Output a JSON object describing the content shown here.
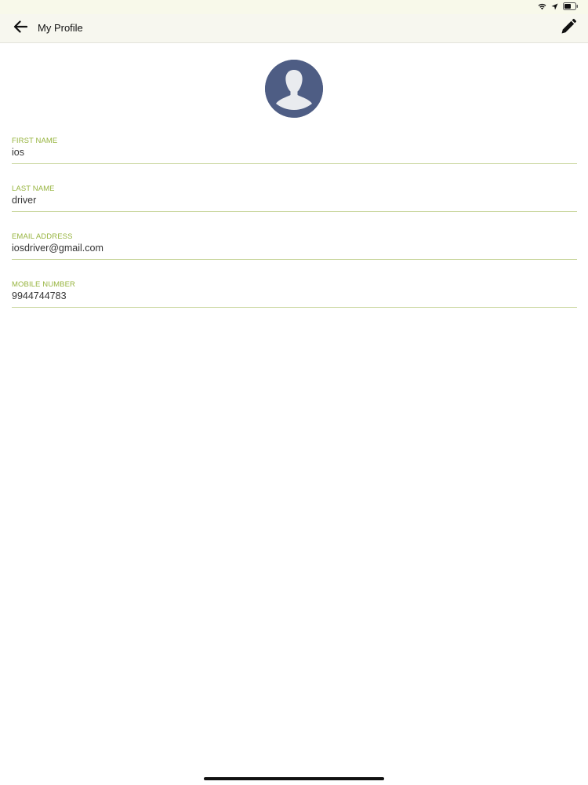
{
  "status_bar": {
    "icons": [
      "wifi-icon",
      "location-icon",
      "battery-icon"
    ]
  },
  "header": {
    "title": "My Profile",
    "back_icon": "arrow-left-icon",
    "edit_icon": "pencil-icon"
  },
  "profile": {
    "avatar_icon": "user-silhouette-icon",
    "fields": [
      {
        "label": "FIRST NAME",
        "value": "ios"
      },
      {
        "label": "LAST NAME",
        "value": "driver"
      },
      {
        "label": "EMAIL ADDRESS",
        "value": "iosdriver@gmail.com"
      },
      {
        "label": "MOBILE NUMBER",
        "value": "9944744783"
      }
    ]
  },
  "colors": {
    "accent_label": "#97b43f",
    "underline": "#c9d69d",
    "header_bg": "#f7f7ef",
    "avatar_bg": "#4e5d84"
  }
}
